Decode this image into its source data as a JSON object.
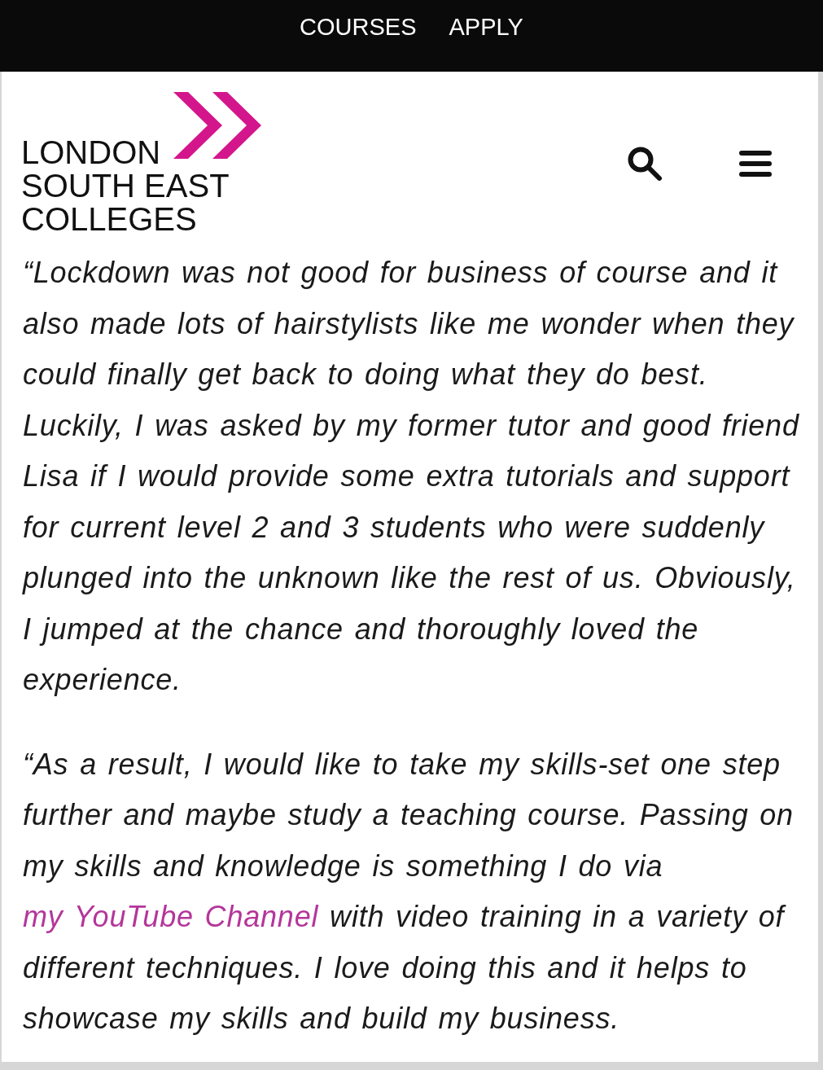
{
  "top_nav": {
    "links": [
      {
        "label": "COURSES"
      },
      {
        "label": "APPLY"
      }
    ]
  },
  "logo": {
    "lines": [
      "LONDON",
      "SOUTH EAST",
      "COLLEGES"
    ]
  },
  "article": {
    "paragraphs": [
      {
        "parts": [
          {
            "kind": "text",
            "text": "“Lockdown was not good for business of course and it also made lots of hairstylists like me wonder when they could finally get back to doing what they do best. Luckily, I was asked by my former tutor and good friend Lisa if I would provide some extra tutorials and support for current level 2 and 3 students who were suddenly plunged into the unknown like the rest of us. Obviously, I jumped at the chance and thoroughly loved the experience."
          }
        ]
      },
      {
        "parts": [
          {
            "kind": "text",
            "text": "“As a result, I would like to take my skills-set one step further and maybe study a teaching course. Passing on my skills and knowledge is something I do via "
          },
          {
            "kind": "link",
            "text": "my YouTube Channel"
          },
          {
            "kind": "text",
            "text": " with video training in a variety of different techniques. I love doing this and it helps to showcase my skills and build my business."
          }
        ]
      }
    ]
  }
}
